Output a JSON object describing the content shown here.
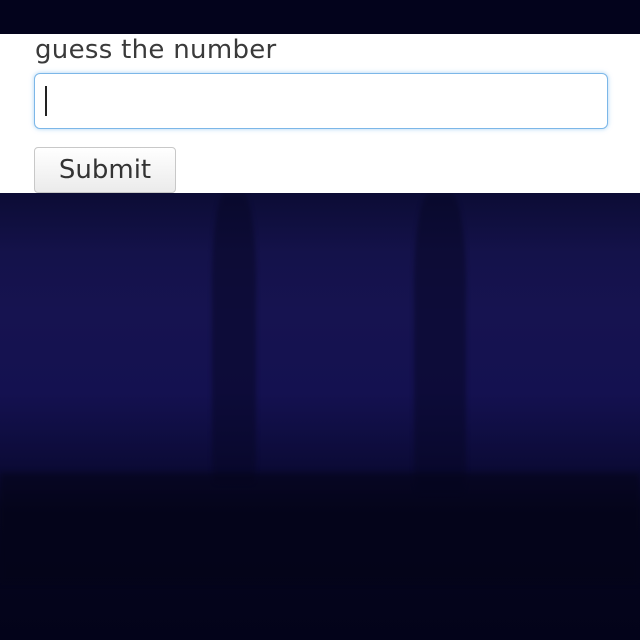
{
  "form": {
    "prompt_label": "guess the number",
    "guess_input": {
      "value": "",
      "placeholder": ""
    },
    "submit_label": "Submit"
  },
  "colors": {
    "accent_focus": "#66afe9",
    "backdrop": "#161350",
    "panel": "#ffffff"
  }
}
